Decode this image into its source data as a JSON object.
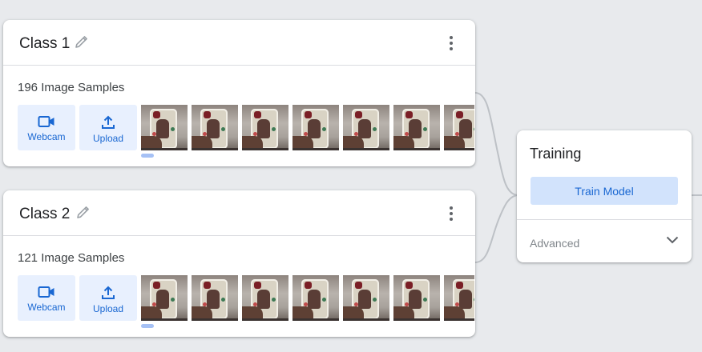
{
  "classes": [
    {
      "title": "Class 1",
      "samples_text": "196 Image Samples",
      "webcam_label": "Webcam",
      "upload_label": "Upload",
      "visible_thumbnails": 7
    },
    {
      "title": "Class 2",
      "samples_text": "121 Image Samples",
      "webcam_label": "Webcam",
      "upload_label": "Upload",
      "visible_thumbnails": 7
    }
  ],
  "training": {
    "title": "Training",
    "train_button_label": "Train Model",
    "advanced_label": "Advanced"
  },
  "icons": {
    "edit": "pencil-icon",
    "menu": "kebab-menu-icon",
    "webcam": "videocam-icon",
    "upload": "upload-icon",
    "expand": "chevron-down-icon"
  },
  "colors": {
    "accent": "#1967d2",
    "button_bg": "#e8f0fe",
    "train_button_bg": "#d2e3fc",
    "canvas_bg": "#e8eaed",
    "scroll_indicator": "#a6c1f5"
  }
}
